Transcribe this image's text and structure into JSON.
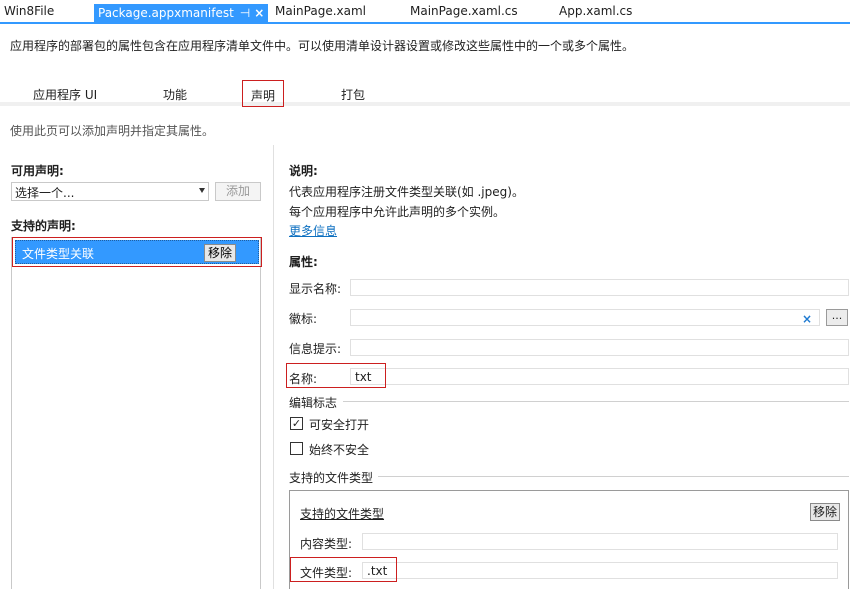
{
  "doc_tabs": [
    "Win8File",
    "Package.appxmanifest",
    "MainPage.xaml",
    "MainPage.xaml.cs",
    "App.xaml.cs"
  ],
  "tab_pin_glyph": "⊣",
  "tab_close_glyph": "×",
  "intro_text": "应用程序的部署包的属性包含在应用程序清单文件中。可以使用清单设计器设置或修改这些属性中的一个或多个属性。",
  "section_tabs": [
    "应用程序 UI",
    "功能",
    "声明",
    "打包"
  ],
  "sub_intro": "使用此页可以添加声明并指定其属性。",
  "left": {
    "available_label": "可用声明:",
    "select_value": "选择一个...",
    "add_button": "添加",
    "supported_label": "支持的声明:",
    "declaration_item": "文件类型关联",
    "remove_button": "移除"
  },
  "right": {
    "desc_label": "说明:",
    "desc_line1": "代表应用程序注册文件类型关联(如 .jpeg)。",
    "desc_line2": "每个应用程序中允许此声明的多个实例。",
    "more_info": "更多信息",
    "props_label": "属性:",
    "display_name_label": "显示名称:",
    "display_name_value": "",
    "logo_label": "徽标:",
    "logo_value": "",
    "clear_glyph": "×",
    "browse_button": "...",
    "info_tip_label": "信息提示:",
    "info_tip_value": "",
    "name_label": "名称:",
    "name_value": "txt",
    "edit_flags_title": "编辑标志",
    "open_is_safe_label": "可安全打开",
    "open_is_safe_checked": true,
    "always_unsafe_label": "始终不安全",
    "always_unsafe_checked": false,
    "supported_file_types_title": "支持的文件类型",
    "inner_title": "支持的文件类型",
    "inner_remove_button": "移除",
    "content_type_label": "内容类型:",
    "content_type_value": "",
    "file_type_label": "文件类型:",
    "file_type_value": ".txt"
  },
  "colors": {
    "accent": "#3399ff",
    "highlight_border": "#cc1f1f",
    "link": "#0e70c0"
  }
}
